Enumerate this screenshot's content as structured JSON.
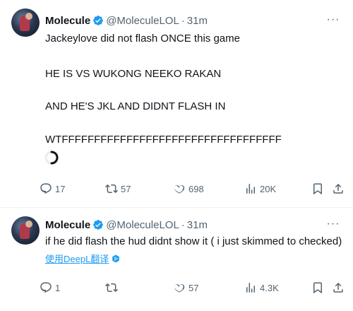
{
  "tweets": [
    {
      "author": {
        "name": "Molecule",
        "handle": "@MoleculeLOL",
        "time": "31m"
      },
      "separator": "·",
      "more_label": "···",
      "lines": [
        "Jackeylove did not flash ONCE this game",
        "HE IS VS WUKONG NEEKO RAKAN",
        "AND HE'S JKL AND DIDNT FLASH IN",
        "WTFFFFFFFFFFFFFFFFFFFFFFFFFFFFFFFFFF"
      ],
      "stats": {
        "replies": "17",
        "retweets": "57",
        "likes": "698",
        "views": "20K"
      }
    },
    {
      "author": {
        "name": "Molecule",
        "handle": "@MoleculeLOL",
        "time": "31m"
      },
      "separator": "·",
      "more_label": "···",
      "lines": [
        "if he did flash the hud didnt show it ( i just skimmed to checked)"
      ],
      "translate_label": "使用DeepL翻译",
      "stats": {
        "replies": "1",
        "retweets": "",
        "likes": "57",
        "views": "4.3K"
      }
    }
  ],
  "icons": {
    "verified": "verified-badge-icon",
    "reply": "reply-icon",
    "retweet": "retweet-icon",
    "like": "heart-icon",
    "views": "views-icon",
    "bookmark": "bookmark-icon",
    "share": "share-icon",
    "more": "more-icon",
    "loading": "loading-spinner-icon",
    "deepl": "deepl-icon"
  },
  "colors": {
    "text": "#0f1419",
    "secondary": "#536471",
    "accent": "#1d9bf0",
    "border": "#eff3f4"
  }
}
